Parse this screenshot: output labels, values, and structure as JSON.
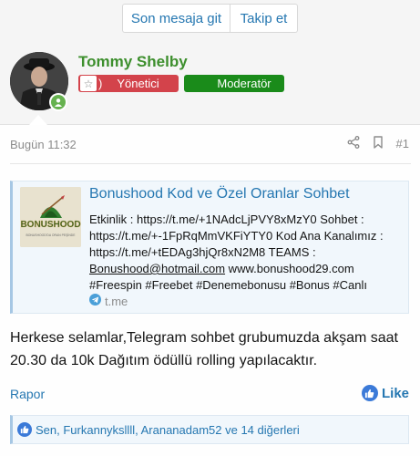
{
  "toolbar": {
    "last_message_label": "Son mesaja git",
    "follow_label": "Takip et"
  },
  "user": {
    "name": "Tommy Shelby",
    "badge_admin": "Yönetici",
    "badge_mod": "Moderatör",
    "online": true
  },
  "post": {
    "date": "Bugün 11:32",
    "number": "#1",
    "embed": {
      "title": "Bonushood Kod ve Özel Oranlar Sohbet",
      "logo_text": "BONUSHOOD",
      "logo_tagline": "BONUSHOOD'DA ORAN PEŞİNDE",
      "line1": "Etkinlik : https://t.me/+1NAdcLjPVY8xMzY0 Sohbet :",
      "line2": "https://t.me/+-1FpRqMmVKFiYTY0 Kod Ana Kanalımız :",
      "line3": "https://t.me/+tEDAg3hjQr8xN2M8 TEAMS :",
      "email": "Bonushood@hotmail.com",
      "line4_rest": " www.bonushood29.com",
      "line5": "#Freespin #Freebet #Denemebonusu #Bonus #Canlı",
      "source": "t.me"
    },
    "message": "Herkese selamlar,Telegram sohbet grubumuzda akşam saat 20.30 da 10k Dağıtım ödüllü rolling yapılacaktır.",
    "report_label": "Rapor",
    "like_label": "Like",
    "reactions_text": "Sen, Furkannyksllll, Arananadam52 ve 14 diğerleri"
  },
  "colors": {
    "accent": "#2577b1",
    "username": "#3d8f2d",
    "admin_badge": "#d3434b",
    "mod_badge": "#1a8b1a"
  }
}
